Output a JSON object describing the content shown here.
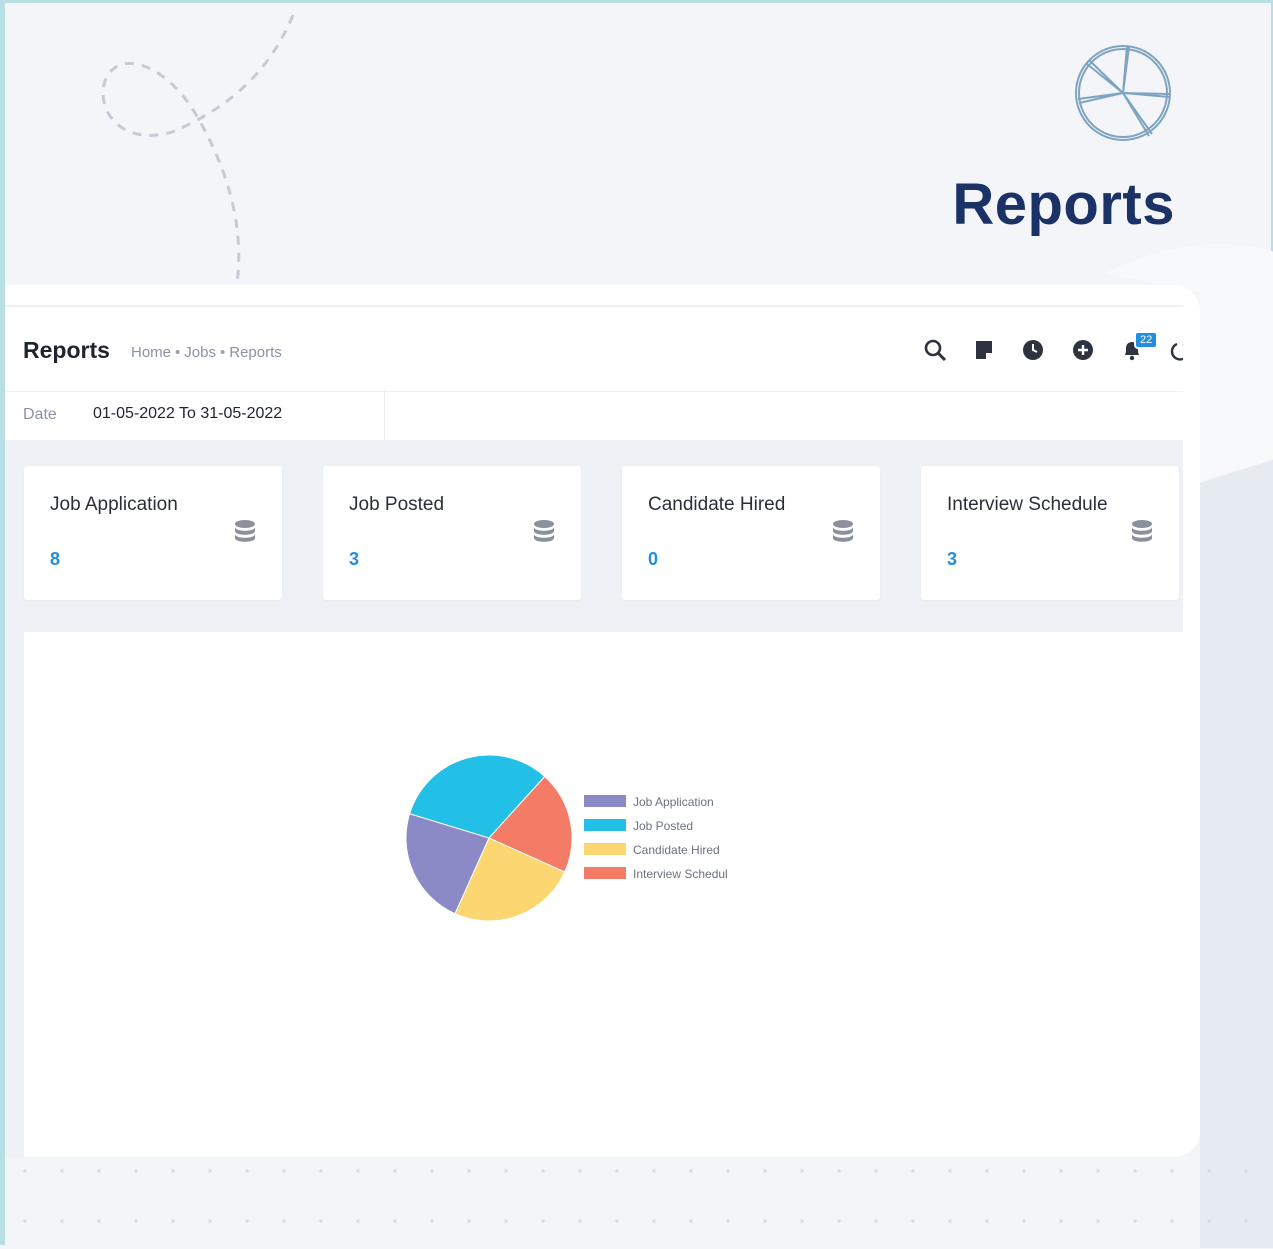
{
  "hero": {
    "title": "Reports",
    "icon": "pie-chart-outline-icon"
  },
  "header": {
    "title": "Reports",
    "breadcrumb": [
      "Home",
      "Jobs",
      "Reports"
    ],
    "notification_count": "22",
    "icons": [
      "search-icon",
      "note-icon",
      "clock-icon",
      "plus-circle-icon",
      "bell-icon",
      "power-icon"
    ]
  },
  "filter": {
    "date_label": "Date",
    "date_range": "01-05-2022 To 31-05-2022"
  },
  "cards": [
    {
      "label": "Job Application",
      "value": "8",
      "icon": "database-icon"
    },
    {
      "label": "Job Posted",
      "value": "3",
      "icon": "database-icon"
    },
    {
      "label": "Candidate Hired",
      "value": "0",
      "icon": "database-icon"
    },
    {
      "label": "Interview Schedule",
      "value": "3",
      "icon": "database-icon"
    }
  ],
  "colors": {
    "accent": "#1f8fe0",
    "title": "#1a3266",
    "job_application": "#8b8ac6",
    "job_posted": "#22c0e6",
    "candidate_hired": "#fcd670",
    "interview_schedule": "#f47c66"
  },
  "chart_data": {
    "type": "pie",
    "legend_position": "right",
    "slices": [
      {
        "label": "Job Application",
        "value": 23,
        "color": "#8b8ac6"
      },
      {
        "label": "Job Posted",
        "value": 32,
        "color": "#22c0e6"
      },
      {
        "label": "Candidate Hired",
        "value": 25,
        "color": "#fcd670"
      },
      {
        "label": "Interview Schedul",
        "value": 20,
        "color": "#f47c66"
      }
    ]
  }
}
